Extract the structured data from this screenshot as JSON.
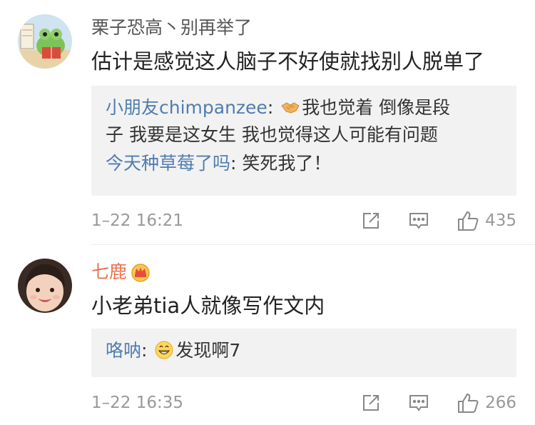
{
  "comments": [
    {
      "user": "栗子恐高丶别再举了",
      "text": "估计是感觉这人脑子不好使就找别人脱单了",
      "replies": [
        {
          "who": "小朋友chimpanzee",
          "text": "我也觉着  倒像是段",
          "text2": "子 我要是这女生 我也觉得这人可能有问题",
          "emoji": "handshake-emoji"
        },
        {
          "who": "今天种草莓了吗",
          "text": "笑死我了！"
        }
      ],
      "time": "1–22 16:21",
      "likes": "435"
    },
    {
      "user": "七鹿",
      "badge": "crown-badge",
      "text": "小老弟tia人就像写作文内",
      "replies": [
        {
          "who": "咯呐",
          "text": "发现啊7",
          "emoji": "grin-emoji"
        }
      ],
      "time": "1–22 16:35",
      "likes": "266"
    }
  ],
  "colors": {
    "link": "#507daf",
    "vip_name": "#eb7350",
    "reply_bg": "#f2f2f2",
    "meta": "#999999"
  }
}
